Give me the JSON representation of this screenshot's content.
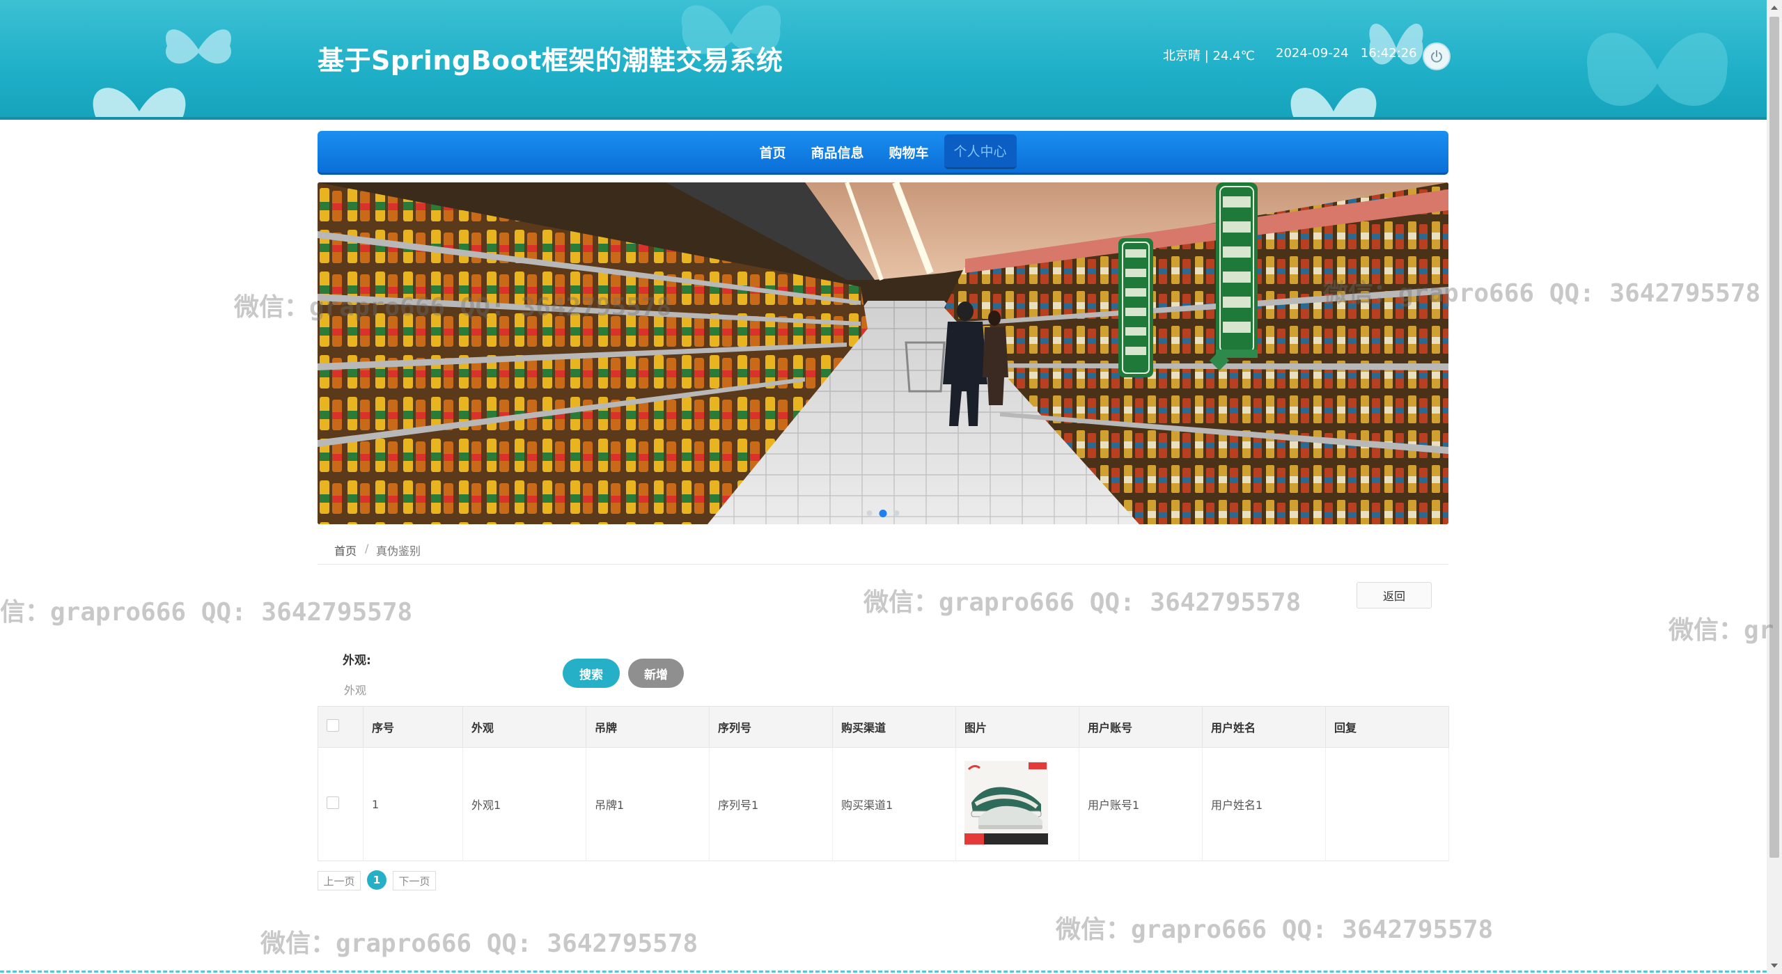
{
  "header": {
    "title": "基于SpringBoot框架的潮鞋交易系统",
    "weather": "北京晴 | 24.4℃",
    "datetime": "2024-09-24   16:42:26",
    "power_icon": "power-icon"
  },
  "nav": {
    "items": [
      {
        "label": "首页",
        "active": false
      },
      {
        "label": "商品信息",
        "active": false
      },
      {
        "label": "购物车",
        "active": false
      },
      {
        "label": "个人中心",
        "active": true
      }
    ]
  },
  "banner": {
    "image": "supermarket-aisle-photo",
    "active_slide": 2,
    "slide_count": 3
  },
  "breadcrumb": {
    "home": "首页",
    "separator": "/",
    "current": "真伪鉴别"
  },
  "back_button": "返回",
  "search": {
    "label": "外观:",
    "placeholder": "外观",
    "value": "",
    "search_button": "搜索",
    "add_button": "新增"
  },
  "table": {
    "headers": [
      "序号",
      "外观",
      "吊牌",
      "序列号",
      "购买渠道",
      "图片",
      "用户账号",
      "用户姓名",
      "回复"
    ],
    "rows": [
      {
        "index": "1",
        "appearance": "外观1",
        "tag": "吊牌1",
        "serial": "序列号1",
        "channel": "购买渠道1",
        "image": "sneaker-thumbnail",
        "account": "用户账号1",
        "name": "用户姓名1",
        "reply": ""
      }
    ]
  },
  "pagination": {
    "prev": "上一页",
    "current": "1",
    "next": "下一页"
  },
  "watermark": {
    "text": "微信：grapro666 QQ: 3642795578",
    "partial_left": "信：grapro666 QQ: 3642795578",
    "partial_right": "微信：gr"
  },
  "colors": {
    "header": "#1fb0c8",
    "nav": "#0a6fd8",
    "accent": "#26b0c8"
  }
}
